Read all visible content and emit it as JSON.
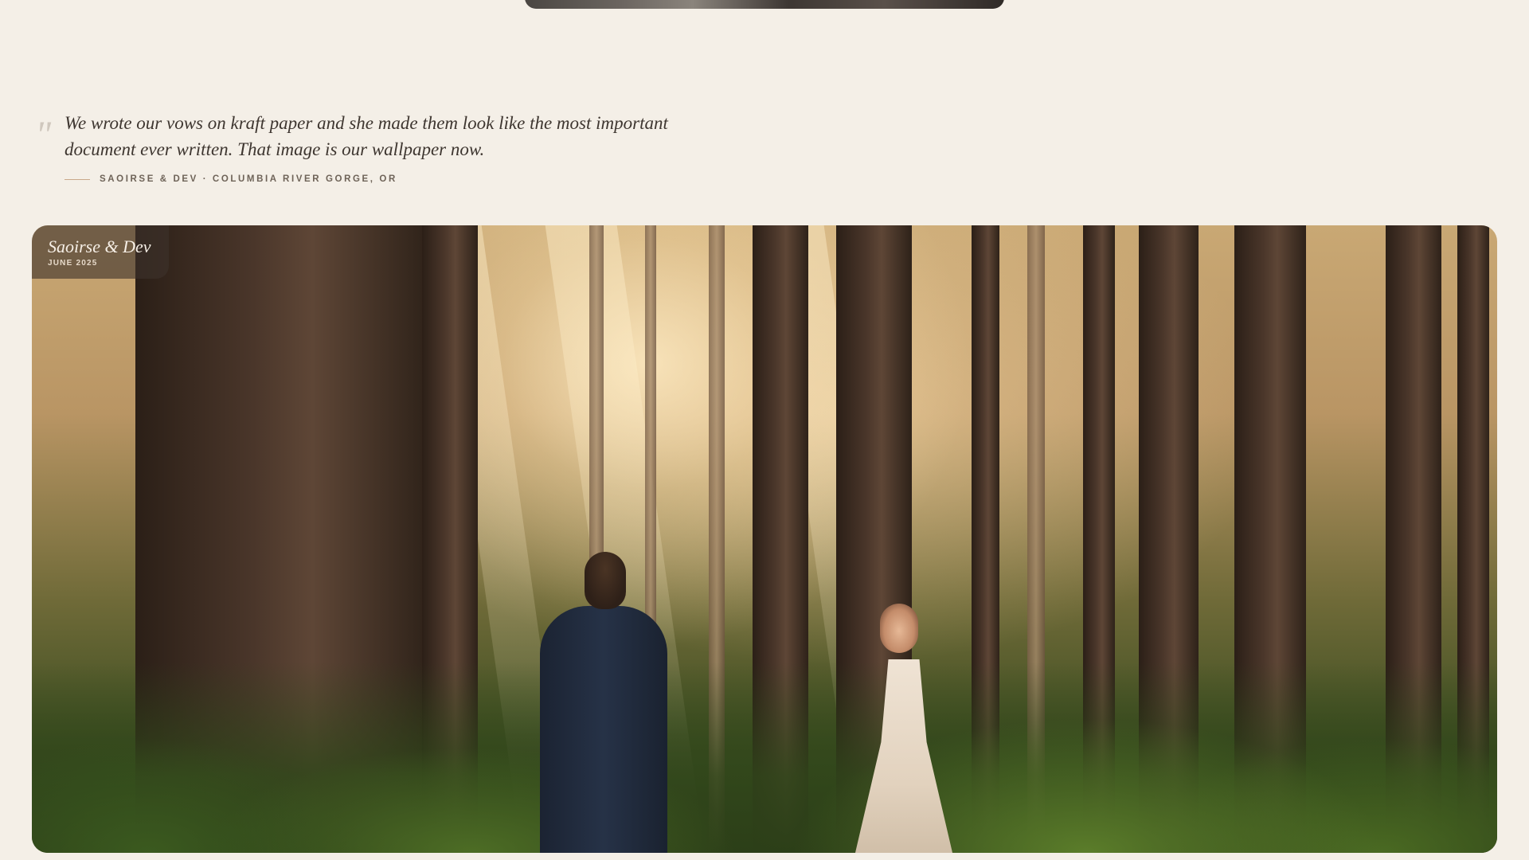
{
  "testimonial": {
    "quote": "We wrote our vows on kraft paper and she made them look like the most important document ever written. That image is our wallpaper now.",
    "attribution": "SAOIRSE & DEV · COLUMBIA RIVER GORGE, OR"
  },
  "hero": {
    "caption_title": "Saoirse & Dev",
    "caption_date": "JUNE 2025"
  },
  "colors": {
    "background": "#f4efe7",
    "text": "#3e3630",
    "accent_rule": "#c9a88a"
  }
}
